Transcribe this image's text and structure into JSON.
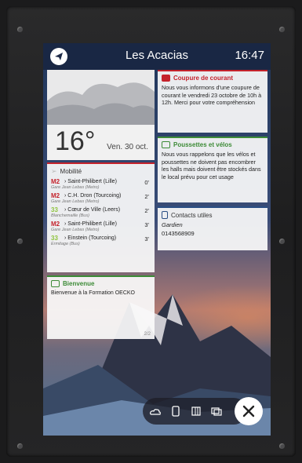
{
  "header": {
    "title": "Les Acacias",
    "time": "16:47"
  },
  "weather": {
    "temperature": "16°",
    "date": "Ven. 30 oct."
  },
  "alert": {
    "title": "Coupure de courant",
    "body": "Nous vous informons d'une coupure de courant le vendredi 23 octobre de 10h à 12h. Merci pour votre compréhension"
  },
  "strollers": {
    "title": "Poussettes et vélos",
    "body": "Nous vous rappelons que les vélos et poussettes ne doivent pas encombrer les halls mais doivent être stockés dans le local prévu pour cet usage"
  },
  "contacts": {
    "title": "Contacts utiles",
    "name": "Gardien",
    "phone": "0143568909"
  },
  "mobility": {
    "title": "Mobilité",
    "rows": [
      {
        "line": "M2",
        "dest": "› Saint-Philibert (Lille)",
        "stop": "Gare Jean Lebas (Metro)",
        "mins": "0'"
      },
      {
        "line": "M2",
        "dest": "› C.H. Dron (Tourcoing)",
        "stop": "Gare Jean Lebas (Metro)",
        "mins": "2'"
      },
      {
        "line": "33",
        "dest": "› Cœur de Ville (Leers)",
        "stop": "Blanchemaille (Bus)",
        "mins": "2'"
      },
      {
        "line": "M2",
        "dest": "› Saint-Philibert (Lille)",
        "stop": "Gare Jean Lebas (Metro)",
        "mins": "3'"
      },
      {
        "line": "33",
        "dest": "› Einstein (Tourcoing)",
        "stop": "Ermitage (Bus)",
        "mins": "3'"
      }
    ]
  },
  "welcome": {
    "title": "Bienvenue",
    "body": "Bienvenue à la Formation OECKO",
    "pager": "2/2"
  },
  "colors": {
    "alert": "#c4232c",
    "green": "#3d8b37",
    "metro": "#c4232c",
    "bus": "#8fc33f",
    "topbar": "#192642"
  }
}
